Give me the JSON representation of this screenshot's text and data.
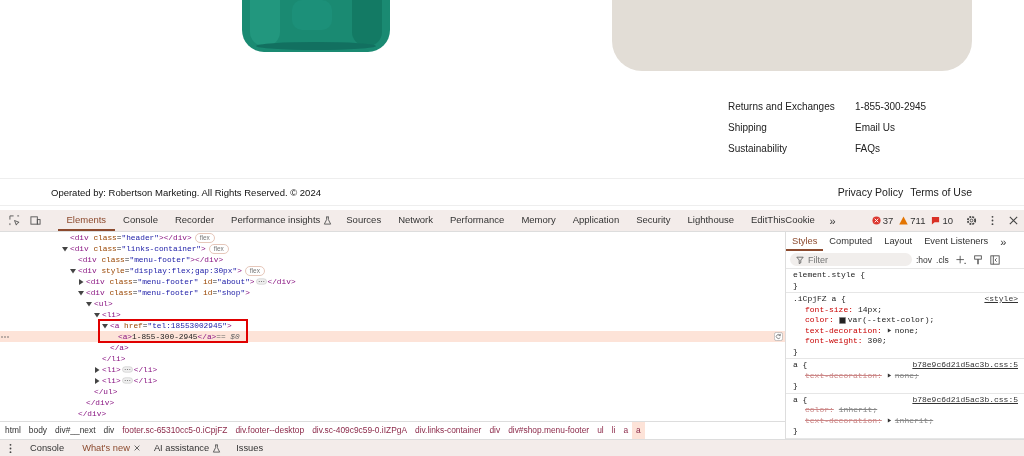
{
  "site": {
    "link_columns": [
      {
        "links": [
          "Returns and Exchanges",
          "Shipping",
          "Sustainability"
        ]
      },
      {
        "links": [
          "1-855-300-2945",
          "Email Us",
          "FAQs"
        ]
      }
    ],
    "copyright": "Operated by: Robertson Marketing. All Rights Reserved. © 2024",
    "legal_links": [
      "Privacy Policy",
      "Terms of Use"
    ]
  },
  "devtools": {
    "tabs": [
      {
        "label": "Elements",
        "selected": true
      },
      {
        "label": "Console",
        "selected": false
      },
      {
        "label": "Recorder",
        "selected": false
      },
      {
        "label": "Performance insights",
        "selected": false,
        "experimental": true
      },
      {
        "label": "Sources",
        "selected": false
      },
      {
        "label": "Network",
        "selected": false
      },
      {
        "label": "Performance",
        "selected": false
      },
      {
        "label": "Memory",
        "selected": false
      },
      {
        "label": "Application",
        "selected": false
      },
      {
        "label": "Security",
        "selected": false
      },
      {
        "label": "Lighthouse",
        "selected": false
      },
      {
        "label": "EditThisCookie",
        "selected": false
      }
    ],
    "more": "»",
    "counters": [
      {
        "kind": "error",
        "count": "37"
      },
      {
        "kind": "warning",
        "count": "711"
      },
      {
        "kind": "issue",
        "count": "10"
      }
    ],
    "dom_tree": [
      {
        "tag": "<div class=\"header\"></div>",
        "badge": "flex"
      },
      {
        "tag": "<div class=\"links-container\">",
        "badge": "flex",
        "expanded": true,
        "children": [
          {
            "tag": "<div class=\"menu-footer\"></div>"
          },
          {
            "tag": "<div style=\"display:flex;gap:30px\">",
            "badge": "flex",
            "expanded": true,
            "close": "</div>",
            "children": [
              {
                "tag": "<div class=\"menu-footer\" id=\"about\">",
                "expanded": false,
                "close": "</div>"
              },
              {
                "tag": "<div class=\"menu-footer\" id=\"shop\">",
                "expanded": true,
                "close": "</div>",
                "children": [
                  {
                    "tag": "<ul>",
                    "expanded": true,
                    "close": "</ul>",
                    "children": [
                      {
                        "tag": "<li>",
                        "expanded": true,
                        "close": "</li>",
                        "children": [
                          {
                            "tag": "<a href=\"tel:18553002945\">",
                            "expanded": true,
                            "boxed": true,
                            "close": "</a>",
                            "children": [
                              {
                                "tag": "<a>1-855-300-2945</a>",
                                "selected": true,
                                "suffix": "== $0"
                              }
                            ]
                          }
                        ]
                      },
                      {
                        "tag": "<li>",
                        "expanded": false,
                        "close": "</li>"
                      },
                      {
                        "tag": "<li>",
                        "expanded": false,
                        "close": "</li>"
                      }
                    ]
                  }
                ]
              }
            ]
          }
        ]
      }
    ],
    "breadcrumbs": [
      {
        "label": "html",
        "selected": false
      },
      {
        "label": "body",
        "selected": false
      },
      {
        "label": "div#__next",
        "selected": false
      },
      {
        "label": "div",
        "selected": false
      },
      {
        "label": "footer.sc-65310cc5-0.iCpjFZ",
        "selected": false
      },
      {
        "label": "div.footer--desktop",
        "selected": false
      },
      {
        "label": "div.sc-409c9c59-0.iIZPgA",
        "selected": false
      },
      {
        "label": "div.links-container",
        "selected": false
      },
      {
        "label": "div",
        "selected": false
      },
      {
        "label": "div#shop.menu-footer",
        "selected": false
      },
      {
        "label": "ul",
        "selected": false
      },
      {
        "label": "li",
        "selected": false
      },
      {
        "label": "a",
        "selected": false
      },
      {
        "label": "a",
        "selected": true
      }
    ],
    "styles": {
      "tabs": [
        {
          "label": "Styles",
          "selected": true
        },
        {
          "label": "Computed",
          "selected": false
        },
        {
          "label": "Layout",
          "selected": false
        },
        {
          "label": "Event Listeners",
          "selected": false
        }
      ],
      "more": "»",
      "filter": {
        "placeholder": "Filter"
      },
      "hov": ":hov",
      "cls": ".cls",
      "rules": [
        {
          "selector": "element.style {",
          "close": "}"
        },
        {
          "selector": ".iCpjFZ a {",
          "source": "<style>",
          "close": "}",
          "declarations": [
            {
              "prop": "font-size:",
              "value": "14px;",
              "struck": false
            },
            {
              "prop": "color:",
              "value": "var(--text-color);",
              "struck": false,
              "swatch": true
            },
            {
              "prop": "text-decoration:",
              "value": "none;",
              "struck": false,
              "expandable": true
            },
            {
              "prop": "font-weight:",
              "value": "300;",
              "struck": false
            }
          ]
        },
        {
          "selector": "a {",
          "source": "b78e9c6d21d5ac3b.css:5",
          "close": "}",
          "declarations": [
            {
              "prop": "text-decoration:",
              "value": "none;",
              "struck": true,
              "expandable": true
            }
          ]
        },
        {
          "selector": "a {",
          "source": "b78e9c6d21d5ac3b.css:5",
          "close": "}",
          "declarations": [
            {
              "prop": "color:",
              "value": "inherit;",
              "struck": true
            },
            {
              "prop": "text-decoration:",
              "value": "inherit;",
              "struck": true,
              "expandable": true
            }
          ]
        }
      ]
    },
    "drawer_tabs": [
      {
        "label": "Console",
        "selected": false
      },
      {
        "label": "What's new",
        "selected": true,
        "closable": true
      },
      {
        "label": "AI assistance",
        "selected": false,
        "experimental": true
      },
      {
        "label": "Issues",
        "selected": false
      }
    ]
  }
}
